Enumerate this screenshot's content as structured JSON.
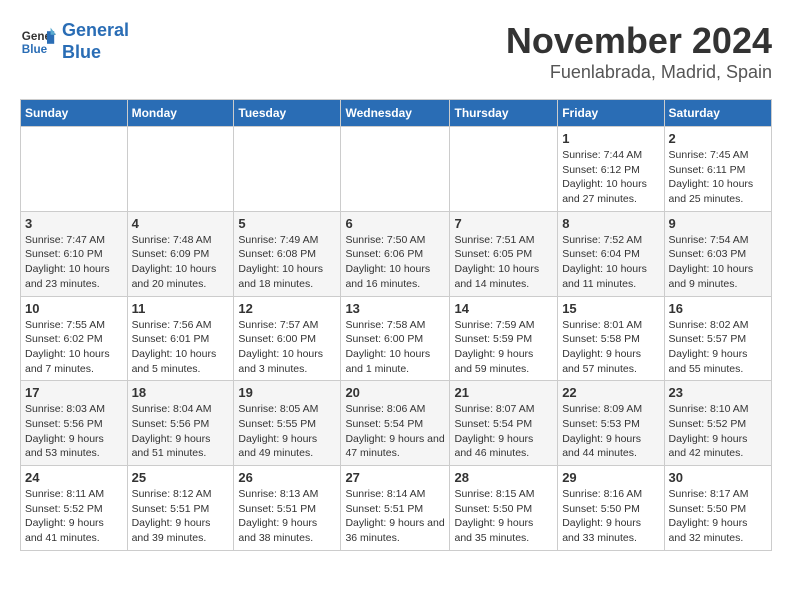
{
  "header": {
    "logo_line1": "General",
    "logo_line2": "Blue",
    "month": "November 2024",
    "location": "Fuenlabrada, Madrid, Spain"
  },
  "weekdays": [
    "Sunday",
    "Monday",
    "Tuesday",
    "Wednesday",
    "Thursday",
    "Friday",
    "Saturday"
  ],
  "weeks": [
    [
      {
        "day": "",
        "info": ""
      },
      {
        "day": "",
        "info": ""
      },
      {
        "day": "",
        "info": ""
      },
      {
        "day": "",
        "info": ""
      },
      {
        "day": "",
        "info": ""
      },
      {
        "day": "1",
        "info": "Sunrise: 7:44 AM\nSunset: 6:12 PM\nDaylight: 10 hours and 27 minutes."
      },
      {
        "day": "2",
        "info": "Sunrise: 7:45 AM\nSunset: 6:11 PM\nDaylight: 10 hours and 25 minutes."
      }
    ],
    [
      {
        "day": "3",
        "info": "Sunrise: 7:47 AM\nSunset: 6:10 PM\nDaylight: 10 hours and 23 minutes."
      },
      {
        "day": "4",
        "info": "Sunrise: 7:48 AM\nSunset: 6:09 PM\nDaylight: 10 hours and 20 minutes."
      },
      {
        "day": "5",
        "info": "Sunrise: 7:49 AM\nSunset: 6:08 PM\nDaylight: 10 hours and 18 minutes."
      },
      {
        "day": "6",
        "info": "Sunrise: 7:50 AM\nSunset: 6:06 PM\nDaylight: 10 hours and 16 minutes."
      },
      {
        "day": "7",
        "info": "Sunrise: 7:51 AM\nSunset: 6:05 PM\nDaylight: 10 hours and 14 minutes."
      },
      {
        "day": "8",
        "info": "Sunrise: 7:52 AM\nSunset: 6:04 PM\nDaylight: 10 hours and 11 minutes."
      },
      {
        "day": "9",
        "info": "Sunrise: 7:54 AM\nSunset: 6:03 PM\nDaylight: 10 hours and 9 minutes."
      }
    ],
    [
      {
        "day": "10",
        "info": "Sunrise: 7:55 AM\nSunset: 6:02 PM\nDaylight: 10 hours and 7 minutes."
      },
      {
        "day": "11",
        "info": "Sunrise: 7:56 AM\nSunset: 6:01 PM\nDaylight: 10 hours and 5 minutes."
      },
      {
        "day": "12",
        "info": "Sunrise: 7:57 AM\nSunset: 6:00 PM\nDaylight: 10 hours and 3 minutes."
      },
      {
        "day": "13",
        "info": "Sunrise: 7:58 AM\nSunset: 6:00 PM\nDaylight: 10 hours and 1 minute."
      },
      {
        "day": "14",
        "info": "Sunrise: 7:59 AM\nSunset: 5:59 PM\nDaylight: 9 hours and 59 minutes."
      },
      {
        "day": "15",
        "info": "Sunrise: 8:01 AM\nSunset: 5:58 PM\nDaylight: 9 hours and 57 minutes."
      },
      {
        "day": "16",
        "info": "Sunrise: 8:02 AM\nSunset: 5:57 PM\nDaylight: 9 hours and 55 minutes."
      }
    ],
    [
      {
        "day": "17",
        "info": "Sunrise: 8:03 AM\nSunset: 5:56 PM\nDaylight: 9 hours and 53 minutes."
      },
      {
        "day": "18",
        "info": "Sunrise: 8:04 AM\nSunset: 5:56 PM\nDaylight: 9 hours and 51 minutes."
      },
      {
        "day": "19",
        "info": "Sunrise: 8:05 AM\nSunset: 5:55 PM\nDaylight: 9 hours and 49 minutes."
      },
      {
        "day": "20",
        "info": "Sunrise: 8:06 AM\nSunset: 5:54 PM\nDaylight: 9 hours and 47 minutes."
      },
      {
        "day": "21",
        "info": "Sunrise: 8:07 AM\nSunset: 5:54 PM\nDaylight: 9 hours and 46 minutes."
      },
      {
        "day": "22",
        "info": "Sunrise: 8:09 AM\nSunset: 5:53 PM\nDaylight: 9 hours and 44 minutes."
      },
      {
        "day": "23",
        "info": "Sunrise: 8:10 AM\nSunset: 5:52 PM\nDaylight: 9 hours and 42 minutes."
      }
    ],
    [
      {
        "day": "24",
        "info": "Sunrise: 8:11 AM\nSunset: 5:52 PM\nDaylight: 9 hours and 41 minutes."
      },
      {
        "day": "25",
        "info": "Sunrise: 8:12 AM\nSunset: 5:51 PM\nDaylight: 9 hours and 39 minutes."
      },
      {
        "day": "26",
        "info": "Sunrise: 8:13 AM\nSunset: 5:51 PM\nDaylight: 9 hours and 38 minutes."
      },
      {
        "day": "27",
        "info": "Sunrise: 8:14 AM\nSunset: 5:51 PM\nDaylight: 9 hours and 36 minutes."
      },
      {
        "day": "28",
        "info": "Sunrise: 8:15 AM\nSunset: 5:50 PM\nDaylight: 9 hours and 35 minutes."
      },
      {
        "day": "29",
        "info": "Sunrise: 8:16 AM\nSunset: 5:50 PM\nDaylight: 9 hours and 33 minutes."
      },
      {
        "day": "30",
        "info": "Sunrise: 8:17 AM\nSunset: 5:50 PM\nDaylight: 9 hours and 32 minutes."
      }
    ]
  ]
}
